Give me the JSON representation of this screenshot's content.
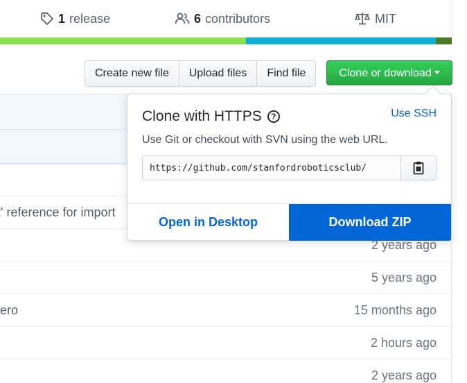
{
  "summary": {
    "releases": {
      "count": "1",
      "label": "release",
      "icon": "tag-icon"
    },
    "contributors": {
      "count": "6",
      "label": "contributors",
      "icon": "people-icon"
    },
    "license": {
      "label": "MIT",
      "icon": "law-icon"
    }
  },
  "language_bar": {
    "segments": [
      {
        "color": "#89e051",
        "fraction": 0.545
      },
      {
        "color": "#0eaed6",
        "fraction": 0.42
      },
      {
        "color": "#4d7a1e",
        "fraction": 0.035
      }
    ]
  },
  "toolbar": {
    "create_new_file": "Create new file",
    "upload_files": "Upload files",
    "find_file": "Find file",
    "clone_or_download": "Clone or download"
  },
  "clone_dropdown": {
    "title": "Clone with HTTPS",
    "use_ssh": "Use SSH",
    "description": "Use Git or checkout with SVN using the web URL.",
    "url": "https://github.com/stanfordroboticsclub/",
    "open_in_desktop": "Open in Desktop",
    "download_zip": "Download ZIP"
  },
  "file_rows": [
    {
      "message": "",
      "age": ""
    },
    {
      "message": "t' reference for import",
      "age": ""
    },
    {
      "message": "",
      "age": "2 years ago"
    },
    {
      "message": "",
      "age": "5 years ago"
    },
    {
      "message": "ero",
      "age": "15 months ago"
    },
    {
      "message": "",
      "age": "2 hours ago"
    },
    {
      "message": "",
      "age": "2 years ago"
    }
  ],
  "colors": {
    "link": "#0366d6",
    "clone_green": "#28a745",
    "primary_blue": "#0366d6"
  }
}
